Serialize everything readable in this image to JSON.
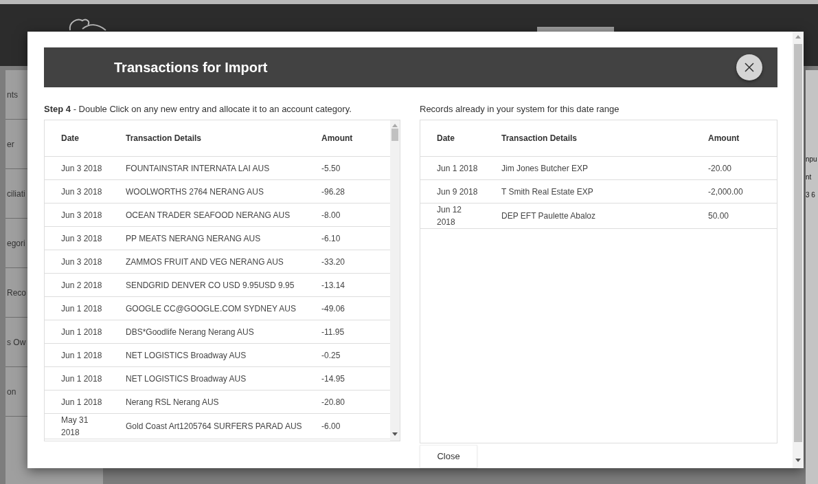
{
  "background": {
    "sidebar_items": [
      "nts",
      "er",
      "ciliati",
      "egori",
      "Reco",
      "s Ow",
      "on"
    ],
    "right_fragments": [
      "npu",
      "nt",
      "3 6"
    ]
  },
  "modal": {
    "title": "Transactions for Import",
    "left": {
      "instruction": "**Step 4** - Double Click on any new entry and allocate it to an account category.",
      "columns": [
        "Date",
        "Transaction Details",
        "Amount"
      ],
      "rows": [
        {
          "date": "Jun 3 2018",
          "details": "FOUNTAINSTAR INTERNATA LAI AUS",
          "amount": "-5.50"
        },
        {
          "date": "Jun 3 2018",
          "details": "WOOLWORTHS 2764 NERANG AUS",
          "amount": "-96.28"
        },
        {
          "date": "Jun 3 2018",
          "details": "OCEAN TRADER SEAFOOD NERANG AUS",
          "amount": "-8.00"
        },
        {
          "date": "Jun 3 2018",
          "details": "PP MEATS NERANG NERANG AUS",
          "amount": "-6.10"
        },
        {
          "date": "Jun 3 2018",
          "details": "ZAMMOS FRUIT AND VEG NERANG AUS",
          "amount": "-33.20"
        },
        {
          "date": "Jun 2 2018",
          "details": "SENDGRID DENVER CO USD 9.95USD 9.95",
          "amount": "-13.14"
        },
        {
          "date": "Jun 1 2018",
          "details": "GOOGLE CC@GOOGLE.COM SYDNEY AUS",
          "amount": "-49.06"
        },
        {
          "date": "Jun 1 2018",
          "details": "DBS*Goodlife Nerang Nerang AUS",
          "amount": "-11.95"
        },
        {
          "date": "Jun 1 2018",
          "details": "NET LOGISTICS Broadway AUS",
          "amount": "-0.25"
        },
        {
          "date": "Jun 1 2018",
          "details": "NET LOGISTICS Broadway AUS",
          "amount": "-14.95"
        },
        {
          "date": "Jun 1 2018",
          "details": "Nerang RSL Nerang AUS",
          "amount": "-20.80"
        },
        {
          "date": "May 31 2018",
          "details": "Gold Coast Art1205764 SURFERS PARAD AUS",
          "amount": "-6.00"
        }
      ]
    },
    "right": {
      "instruction": "Records already in your system for this date range",
      "columns": [
        "Date",
        "Transaction Details",
        "Amount"
      ],
      "rows": [
        {
          "date": "Jun 1 2018",
          "details": "Jim Jones Butcher EXP",
          "amount": "-20.00"
        },
        {
          "date": "Jun 9 2018",
          "details": "T Smith Real Estate EXP",
          "amount": "-2,000.00"
        },
        {
          "date": "Jun 12 2018",
          "details": "DEP EFT Paulette Abaloz",
          "amount": "50.00"
        }
      ]
    },
    "close_button": "Close"
  }
}
